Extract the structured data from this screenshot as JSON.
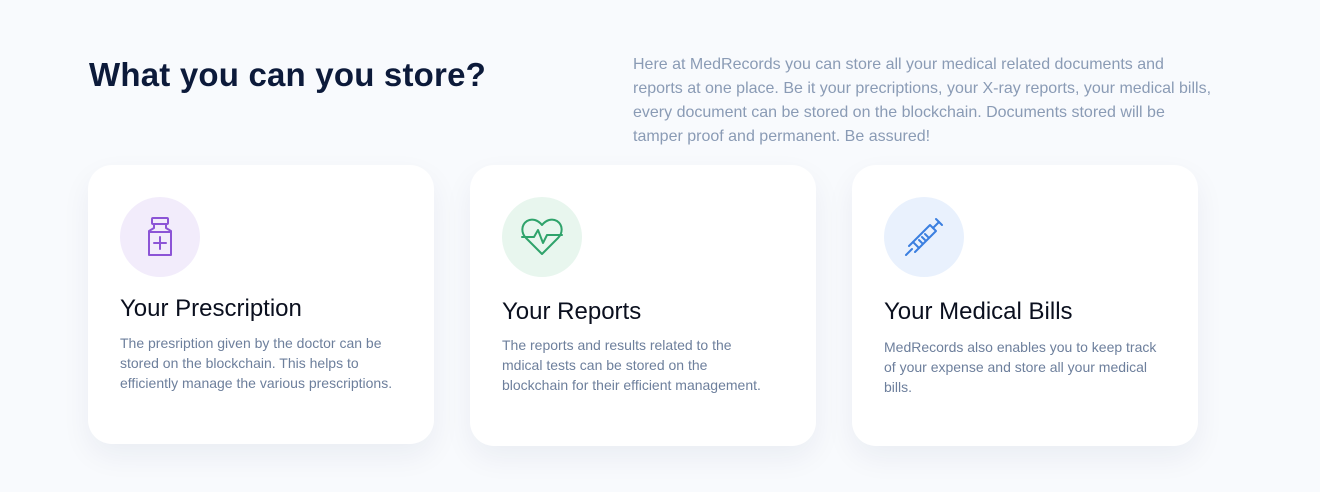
{
  "section": {
    "title": "What you can you store?",
    "intro": "Here at MedRecords you can store all your medical related documents and reports at one place. Be it your precriptions, your X-ray reports, your medical bills, every document can be stored on the blockchain. Documents stored will be tamper proof and permanent. Be assured!"
  },
  "cards": [
    {
      "title": "Your Prescription",
      "text": "The presription given by the doctor can be stored on the blockchain. This helps to efficiently manage the various prescriptions.",
      "icon": "medicine-bottle-icon",
      "icon_color": "#8c54d6",
      "icon_bg": "#f2ecfb"
    },
    {
      "title": "Your Reports",
      "text": "The reports and results related to the mdical tests can be stored on the blockchain for their efficient management.",
      "icon": "heartbeat-icon",
      "icon_color": "#2fa36b",
      "icon_bg": "#e8f6ee"
    },
    {
      "title": "Your Medical Bills",
      "text": "MedRecords also enables you to keep track of your expense and store all your medical bills.",
      "icon": "syringe-icon",
      "icon_color": "#3b7fe0",
      "icon_bg": "#e9f1fd"
    }
  ]
}
